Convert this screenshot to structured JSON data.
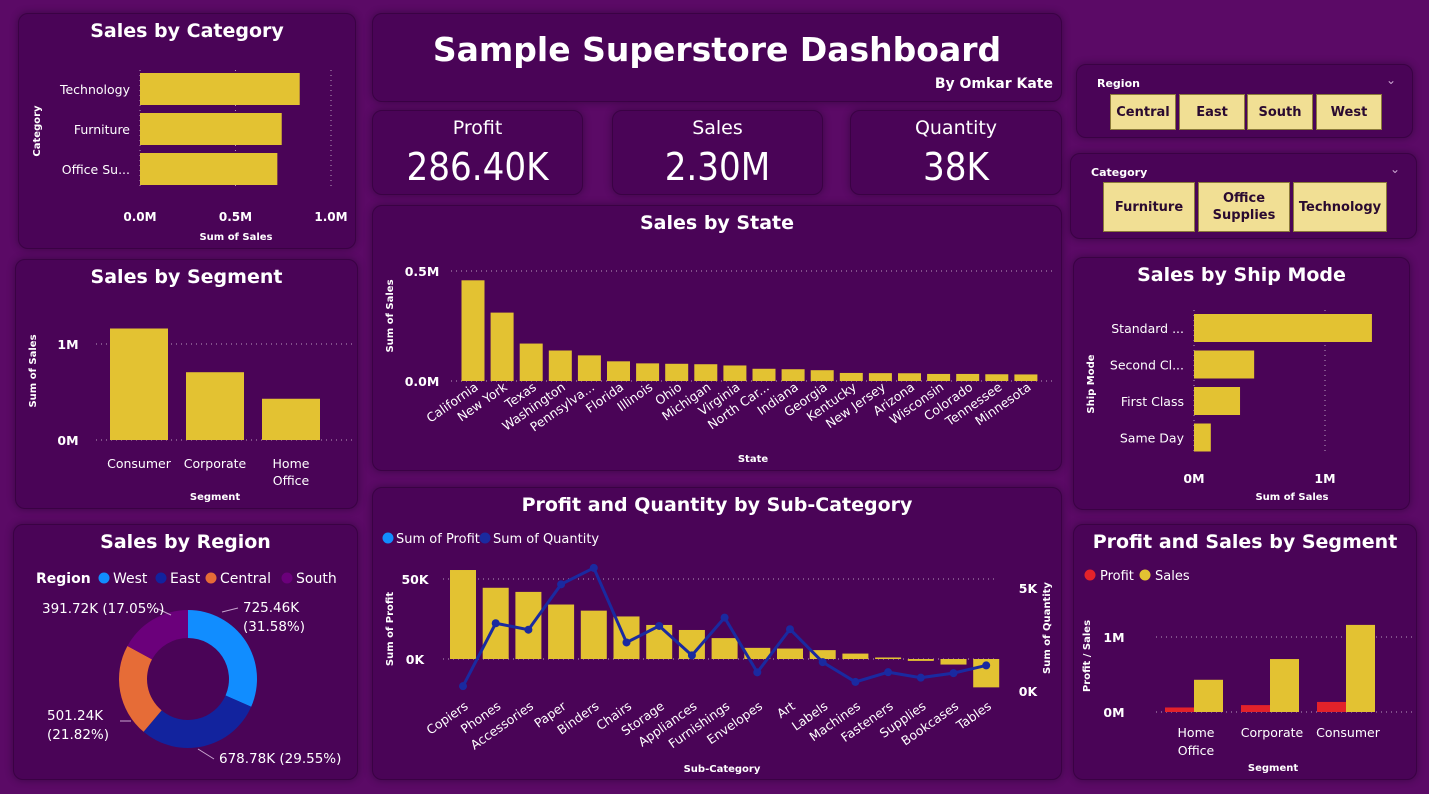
{
  "header": {
    "title": "Sample Superstore Dashboard",
    "subtitle": "By Omkar Kate"
  },
  "kpis": {
    "profit": {
      "label": "Profit",
      "value": "286.40K"
    },
    "sales": {
      "label": "Sales",
      "value": "2.30M"
    },
    "quantity": {
      "label": "Quantity",
      "value": "38K"
    }
  },
  "slicers": {
    "region": {
      "title": "Region",
      "options": [
        "Central",
        "East",
        "South",
        "West"
      ]
    },
    "category": {
      "title": "Category",
      "options": [
        "Furniture",
        "Office\nSupplies",
        "Technology"
      ]
    }
  },
  "colors": {
    "bar": "#e3c232",
    "profit_bar": "#e3222a",
    "line": "#1a2aa0",
    "background": "#4a0457"
  },
  "icons": {
    "slicer_dropdown": "chevron-down-icon"
  },
  "chart_data": [
    {
      "id": "sales_by_category",
      "type": "bar",
      "orientation": "horizontal",
      "title": "Sales by Category",
      "categories": [
        "Technology",
        "Furniture",
        "Office Su..."
      ],
      "values": [
        836154,
        741999,
        719047
      ],
      "xlabel": "Sum of Sales",
      "ylabel": "Category",
      "xticks": [
        "0.0M",
        "0.5M",
        "1.0M"
      ],
      "xlim": [
        0,
        1000000
      ],
      "grid": true
    },
    {
      "id": "sales_by_segment",
      "type": "bar",
      "title": "Sales by Segment",
      "categories": [
        "Consumer",
        "Corporate",
        "Home\nOffice"
      ],
      "values": [
        1161401,
        706146,
        429653
      ],
      "xlabel": "Segment",
      "ylabel": "Sum of Sales",
      "yticks": [
        "0M",
        "1M"
      ],
      "ylim": [
        0,
        1250000
      ],
      "grid": true
    },
    {
      "id": "sales_by_region",
      "type": "pie",
      "donut": true,
      "title": "Sales by Region",
      "legend_title": "Region",
      "labels": [
        "West",
        "East",
        "Central",
        "South"
      ],
      "values": [
        725460,
        678780,
        501240,
        391720
      ],
      "data_labels": [
        "725.46K\n(31.58%)",
        "678.78K (29.55%)",
        "501.24K\n(21.82%)",
        "391.72K (17.05%)"
      ],
      "colors": [
        "#118dff",
        "#12239e",
        "#e66c37",
        "#6b007b"
      ],
      "legend": "top"
    },
    {
      "id": "sales_by_state",
      "type": "bar",
      "title": "Sales by State",
      "categories": [
        "California",
        "New York",
        "Texas",
        "Washington",
        "Pennsylva...",
        "Florida",
        "Illinois",
        "Ohio",
        "Michigan",
        "Virginia",
        "North Car...",
        "Indiana",
        "Georgia",
        "Kentucky",
        "New Jersey",
        "Arizona",
        "Wisconsin",
        "Colorado",
        "Tennessee",
        "Minnesota"
      ],
      "values": [
        457688,
        310876,
        170188,
        138641,
        116512,
        89474,
        80166,
        78258,
        76270,
        70637,
        55603,
        53555,
        49096,
        36592,
        35764,
        35282,
        32115,
        32108,
        30662,
        29863
      ],
      "xlabel": "State",
      "ylabel": "Sum of Sales",
      "yticks": [
        "0.0M",
        "0.5M"
      ],
      "ylim": [
        0,
        500000
      ],
      "grid": true
    },
    {
      "id": "profit_quantity_subcategory",
      "type": "bar",
      "title": "Profit and Quantity by Sub-Category",
      "categories": [
        "Copiers",
        "Phones",
        "Accessories",
        "Paper",
        "Binders",
        "Chairs",
        "Storage",
        "Appliances",
        "Furnishings",
        "Envelopes",
        "Art",
        "Labels",
        "Machines",
        "Fasteners",
        "Supplies",
        "Bookcases",
        "Tables"
      ],
      "series": [
        {
          "name": "Sum of Profit",
          "type": "bar",
          "axis": "left",
          "values": [
            55618,
            44516,
            41937,
            34054,
            30222,
            26590,
            21279,
            18138,
            13059,
            6964,
            6528,
            5546,
            3385,
            950,
            -1189,
            -3473,
            -17725
          ]
        },
        {
          "name": "Sum of Quantity",
          "type": "line",
          "axis": "right",
          "values": [
            234,
            3289,
            2976,
            5178,
            5974,
            2356,
            3158,
            1729,
            3563,
            906,
            3000,
            1400,
            440,
            914,
            647,
            868,
            1241
          ]
        }
      ],
      "xlabel": "Sub-Category",
      "ylabel": "Sum of Profit",
      "y2label": "Sum of Quantity",
      "yticks": [
        "0K",
        "50K"
      ],
      "ylim": [
        -20000,
        60000
      ],
      "y2ticks": [
        "0K",
        "5K"
      ],
      "y2lim": [
        0,
        6000
      ],
      "legend": "top-left",
      "grid": true
    },
    {
      "id": "sales_by_ship_mode",
      "type": "bar",
      "orientation": "horizontal",
      "title": "Sales by Ship Mode",
      "categories": [
        "Standard ...",
        "Second Cl...",
        "First Class",
        "Same Day"
      ],
      "values": [
        1358216,
        459194,
        351428,
        128363
      ],
      "xlabel": "Sum of Sales",
      "ylabel": "Ship Mode",
      "xticks": [
        "0M",
        "1M"
      ],
      "xlim": [
        0,
        1400000
      ],
      "grid": true
    },
    {
      "id": "profit_sales_segment",
      "type": "bar",
      "title": "Profit and Sales by Segment",
      "categories": [
        "Home\nOffice",
        "Corporate",
        "Consumer"
      ],
      "series": [
        {
          "name": "Profit",
          "values": [
            60299,
            91979,
            134119
          ]
        },
        {
          "name": "Sales",
          "values": [
            429653,
            706146,
            1161401
          ]
        }
      ],
      "xlabel": "Segment",
      "ylabel": "Profit / Sales",
      "yticks": [
        "0M",
        "1M"
      ],
      "ylim": [
        0,
        1250000
      ],
      "legend": "top-left",
      "grid": true
    }
  ]
}
